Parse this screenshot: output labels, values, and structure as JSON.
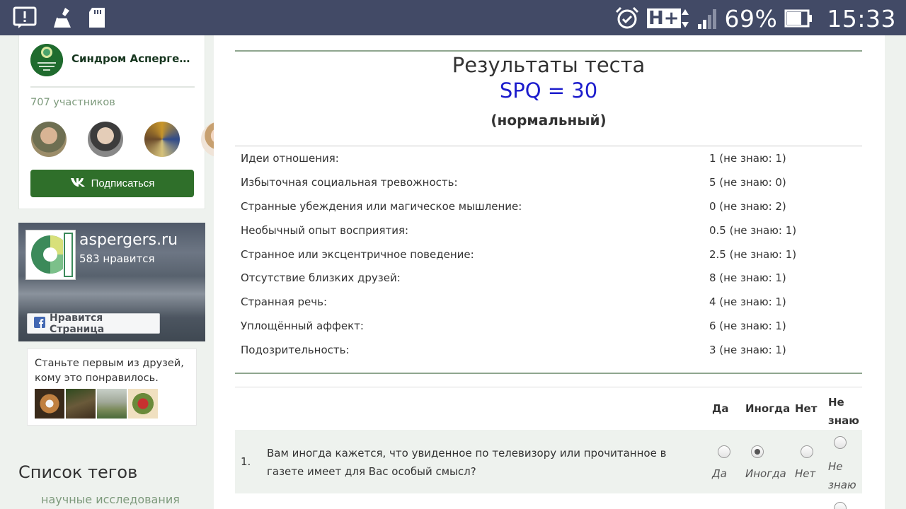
{
  "status_bar": {
    "battery": "69%",
    "time": "15:33",
    "network": "H+"
  },
  "vk_widget": {
    "group_name": "Синдром Аспергера и РАС",
    "members": "707 участников",
    "subscribe_label": "Подписаться"
  },
  "fb_widget": {
    "page_name": "aspergers.ru",
    "likes": "583 нравится",
    "like_button": "Нравится Страница",
    "friends_text": "Станьте первым из друзей, кому это понравилось."
  },
  "tags": {
    "title": "Список тегов",
    "first_tag": "научные исследования"
  },
  "results": {
    "title": "Результаты теста",
    "score": "SPQ = 30",
    "label": "(нормальный)",
    "scales": [
      {
        "name": "Идеи отношения:",
        "value": "1 (не знаю: 1)"
      },
      {
        "name": "Избыточная социальная тревожность:",
        "value": "5 (не знаю: 0)"
      },
      {
        "name": "Странные убеждения или магическое мышление:",
        "value": "0 (не знаю: 2)"
      },
      {
        "name": "Необычный опыт восприятия:",
        "value": "0.5 (не знаю: 1)"
      },
      {
        "name": "Странное или эксцентричное поведение:",
        "value": "2.5 (не знаю: 1)"
      },
      {
        "name": "Отсутствие близких друзей:",
        "value": "8 (не знаю: 1)"
      },
      {
        "name": "Странная речь:",
        "value": "4 (не знаю: 1)"
      },
      {
        "name": "Уплощённый аффект:",
        "value": "6 (не знаю: 1)"
      },
      {
        "name": "Подозрительность:",
        "value": "3 (не знаю: 1)"
      }
    ]
  },
  "questions": {
    "columns": {
      "yes": "Да",
      "sometimes": "Иногда",
      "no": "Нет",
      "dont_know_1": "Не",
      "dont_know_2": "знаю"
    },
    "items": [
      {
        "number": "1.",
        "text": "Вам иногда кажется, что увиденное по телевизору или прочитанное в газете имеет для Вас особый смысл?",
        "selected": "Иногда"
      }
    ]
  },
  "colors": {
    "status_bar": "#424a66",
    "accent_green": "#2f6f2a",
    "score_blue": "#1c1ccc",
    "rule_green": "#8fa68f"
  }
}
